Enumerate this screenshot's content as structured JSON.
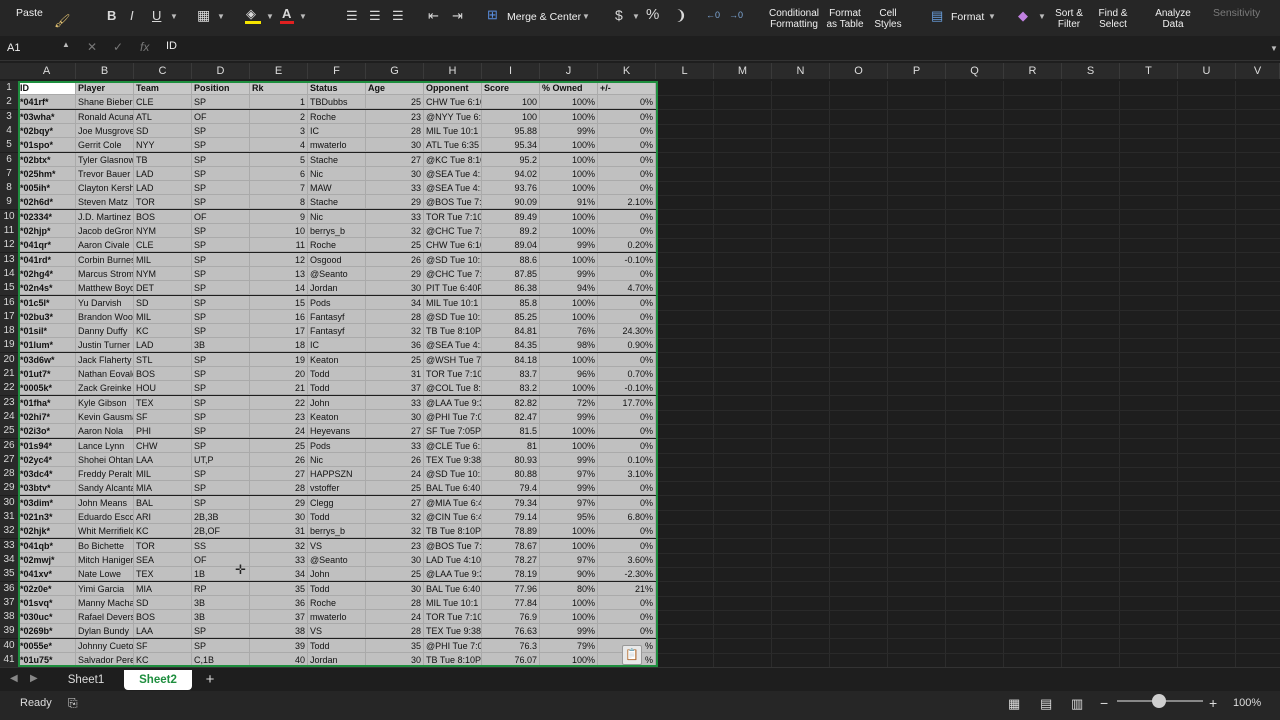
{
  "ribbon": {
    "paste": "Paste",
    "merge_center": "Merge & Center",
    "conditional_formatting": [
      "Conditional",
      "Formatting"
    ],
    "format_as_table": [
      "Format",
      "as Table"
    ],
    "cell_styles": [
      "Cell",
      "Styles"
    ],
    "format": "Format",
    "sort_filter": [
      "Sort &",
      "Filter"
    ],
    "find_select": [
      "Find &",
      "Select"
    ],
    "analyze_data": [
      "Analyze",
      "Data"
    ],
    "sensitivity": "Sensitivity",
    "currency": "$",
    "percent": "%"
  },
  "formula_bar": {
    "name_box": "A1",
    "fx": "fx",
    "content": "ID"
  },
  "columns": [
    "A",
    "B",
    "C",
    "D",
    "E",
    "F",
    "G",
    "H",
    "I",
    "J",
    "K",
    "L",
    "M",
    "N",
    "O",
    "P",
    "Q",
    "R",
    "S",
    "T",
    "U",
    "V"
  ],
  "table": {
    "headers": [
      "ID",
      "Player",
      "Team",
      "Position",
      "Rk",
      "Status",
      "Age",
      "Opponent",
      "Score",
      "% Owned",
      "+/-"
    ],
    "rows": [
      [
        "*041rf*",
        "Shane Bieber",
        "CLE",
        "SP",
        "1",
        "TBDubbs",
        "25",
        "CHW Tue 6:10",
        "100",
        "100%",
        "0%"
      ],
      [
        "*03wha*",
        "Ronald Acuna",
        "ATL",
        "OF",
        "2",
        "Roche",
        "23",
        "@NYY Tue 6:3",
        "100",
        "100%",
        "0%"
      ],
      [
        "*02bqy*",
        "Joe Musgrove",
        "SD",
        "SP",
        "3",
        "IC",
        "28",
        "MIL Tue 10:1",
        "95.88",
        "99%",
        "0%"
      ],
      [
        "*01spo*",
        "Gerrit Cole",
        "NYY",
        "SP",
        "4",
        "mwaterlo",
        "30",
        "ATL Tue 6:35",
        "95.34",
        "100%",
        "0%"
      ],
      [
        "*02btx*",
        "Tyler Glasnow",
        "TB",
        "SP",
        "5",
        "Stache",
        "27",
        "@KC Tue 8:10",
        "95.2",
        "100%",
        "0%"
      ],
      [
        "*025hm*",
        "Trevor Bauer",
        "LAD",
        "SP",
        "6",
        "Nic",
        "30",
        "@SEA Tue 4:1",
        "94.02",
        "100%",
        "0%"
      ],
      [
        "*005ih*",
        "Clayton Kersh",
        "LAD",
        "SP",
        "7",
        "MAW",
        "33",
        "@SEA Tue 4:1",
        "93.76",
        "100%",
        "0%"
      ],
      [
        "*02h6d*",
        "Steven Matz",
        "TOR",
        "SP",
        "8",
        "Stache",
        "29",
        "@BOS Tue 7:",
        "90.09",
        "91%",
        "2.10%"
      ],
      [
        "*02334*",
        "J.D. Martinez",
        "BOS",
        "OF",
        "9",
        "Nic",
        "33",
        "TOR Tue 7:10",
        "89.49",
        "100%",
        "0%"
      ],
      [
        "*02hjp*",
        "Jacob deGrom",
        "NYM",
        "SP",
        "10",
        "berrys_b",
        "32",
        "@CHC Tue 7:",
        "89.2",
        "100%",
        "0%"
      ],
      [
        "*041qr*",
        "Aaron Civale",
        "CLE",
        "SP",
        "11",
        "Roche",
        "25",
        "CHW Tue 6:10",
        "89.04",
        "99%",
        "0.20%"
      ],
      [
        "*041rd*",
        "Corbin Burnes",
        "MIL",
        "SP",
        "12",
        "Osgood",
        "26",
        "@SD Tue 10:1",
        "88.6",
        "100%",
        "-0.10%"
      ],
      [
        "*02hg4*",
        "Marcus Strom",
        "NYM",
        "SP",
        "13",
        "@Seanto",
        "29",
        "@CHC Tue 7:",
        "87.85",
        "99%",
        "0%"
      ],
      [
        "*02n4s*",
        "Matthew Boyd",
        "DET",
        "SP",
        "14",
        "Jordan",
        "30",
        "PIT Tue 6:40P",
        "86.38",
        "94%",
        "4.70%"
      ],
      [
        "*01c5l*",
        "Yu Darvish",
        "SD",
        "SP",
        "15",
        "Pods",
        "34",
        "MIL Tue 10:1",
        "85.8",
        "100%",
        "0%"
      ],
      [
        "*02bu3*",
        "Brandon Woo",
        "MIL",
        "SP",
        "16",
        "Fantasyf",
        "28",
        "@SD Tue 10:1",
        "85.25",
        "100%",
        "0%"
      ],
      [
        "*01sil*",
        "Danny Duffy",
        "KC",
        "SP",
        "17",
        "Fantasyf",
        "32",
        "TB Tue 8:10P",
        "84.81",
        "76%",
        "24.30%"
      ],
      [
        "*01lum*",
        "Justin Turner",
        "LAD",
        "3B",
        "18",
        "IC",
        "36",
        "@SEA Tue 4:1",
        "84.35",
        "98%",
        "0.90%"
      ],
      [
        "*03d6w*",
        "Jack Flaherty",
        "STL",
        "SP",
        "19",
        "Keaton",
        "25",
        "@WSH Tue 7:",
        "84.18",
        "100%",
        "0%"
      ],
      [
        "*01ut7*",
        "Nathan Eovald",
        "BOS",
        "SP",
        "20",
        "Todd",
        "31",
        "TOR Tue 7:10",
        "83.7",
        "96%",
        "0.70%"
      ],
      [
        "*0005k*",
        "Zack Greinke",
        "HOU",
        "SP",
        "21",
        "Todd",
        "37",
        "@COL Tue 8:",
        "83.2",
        "100%",
        "-0.10%"
      ],
      [
        "*01fha*",
        "Kyle Gibson",
        "TEX",
        "SP",
        "22",
        "John",
        "33",
        "@LAA Tue 9:3",
        "82.82",
        "72%",
        "17.70%"
      ],
      [
        "*02hi7*",
        "Kevin Gausma",
        "SF",
        "SP",
        "23",
        "Keaton",
        "30",
        "@PHI Tue 7:0",
        "82.47",
        "99%",
        "0%"
      ],
      [
        "*02i3o*",
        "Aaron Nola",
        "PHI",
        "SP",
        "24",
        "Heyevans",
        "27",
        "SF Tue 7:05P",
        "81.5",
        "100%",
        "0%"
      ],
      [
        "*01s94*",
        "Lance Lynn",
        "CHW",
        "SP",
        "25",
        "Pods",
        "33",
        "@CLE Tue 6:1",
        "81",
        "100%",
        "0%"
      ],
      [
        "*02yc4*",
        "Shohei Ohtan",
        "LAA",
        "UT,P",
        "26",
        "Nic",
        "26",
        "TEX Tue 9:38",
        "80.93",
        "99%",
        "0.10%"
      ],
      [
        "*03dc4*",
        "Freddy Peralt",
        "MIL",
        "SP",
        "27",
        "HAPPSZN",
        "24",
        "@SD Tue 10:1",
        "80.88",
        "97%",
        "3.10%"
      ],
      [
        "*03btv*",
        "Sandy Alcanta",
        "MIA",
        "SP",
        "28",
        "vstoffer",
        "25",
        "BAL Tue 6:40",
        "79.4",
        "99%",
        "0%"
      ],
      [
        "*03dim*",
        "John Means",
        "BAL",
        "SP",
        "29",
        "Clegg",
        "27",
        "@MIA Tue 6:4",
        "79.34",
        "97%",
        "0%"
      ],
      [
        "*021n3*",
        "Eduardo Esco",
        "ARI",
        "2B,3B",
        "30",
        "Todd",
        "32",
        "@CIN Tue 6:4",
        "79.14",
        "95%",
        "6.80%"
      ],
      [
        "*02hjk*",
        "Whit Merrifield",
        "KC",
        "2B,OF",
        "31",
        "berrys_b",
        "32",
        "TB Tue 8:10P",
        "78.89",
        "100%",
        "0%"
      ],
      [
        "*041qb*",
        "Bo Bichette",
        "TOR",
        "SS",
        "32",
        "VS",
        "23",
        "@BOS Tue 7:",
        "78.67",
        "100%",
        "0%"
      ],
      [
        "*02mwj*",
        "Mitch Haniger",
        "SEA",
        "OF",
        "33",
        "@Seanto",
        "30",
        "LAD Tue 4:10",
        "78.27",
        "97%",
        "3.60%"
      ],
      [
        "*041xv*",
        "Nate Lowe",
        "TEX",
        "1B",
        "34",
        "John",
        "25",
        "@LAA Tue 9:3",
        "78.19",
        "90%",
        "-2.30%"
      ],
      [
        "*02z0e*",
        "Yimi Garcia",
        "MIA",
        "RP",
        "35",
        "Todd",
        "30",
        "BAL Tue 6:40",
        "77.96",
        "80%",
        "21%"
      ],
      [
        "*01svq*",
        "Manny Macha",
        "SD",
        "3B",
        "36",
        "Roche",
        "28",
        "MIL Tue 10:1",
        "77.84",
        "100%",
        "0%"
      ],
      [
        "*030uc*",
        "Rafael Devers",
        "BOS",
        "3B",
        "37",
        "mwaterlo",
        "24",
        "TOR Tue 7:10",
        "76.9",
        "100%",
        "0%"
      ],
      [
        "*0269b*",
        "Dylan Bundy",
        "LAA",
        "SP",
        "38",
        "VS",
        "28",
        "TEX Tue 9:38",
        "76.63",
        "99%",
        "0%"
      ],
      [
        "*0055e*",
        "Johnny Cueto",
        "SF",
        "SP",
        "39",
        "Todd",
        "35",
        "@PHI Tue 7:0",
        "76.3",
        "79%",
        "%"
      ],
      [
        "*01u75*",
        "Salvador Pere",
        "KC",
        "C,1B",
        "40",
        "Jordan",
        "30",
        "TB Tue 8:10P",
        "76.07",
        "100%",
        "%"
      ]
    ]
  },
  "sheet_tabs": [
    "Sheet1",
    "Sheet2"
  ],
  "add_sheet": "+",
  "status": {
    "ready": "Ready",
    "zoom": "100%",
    "zoom_level": 1.0
  }
}
